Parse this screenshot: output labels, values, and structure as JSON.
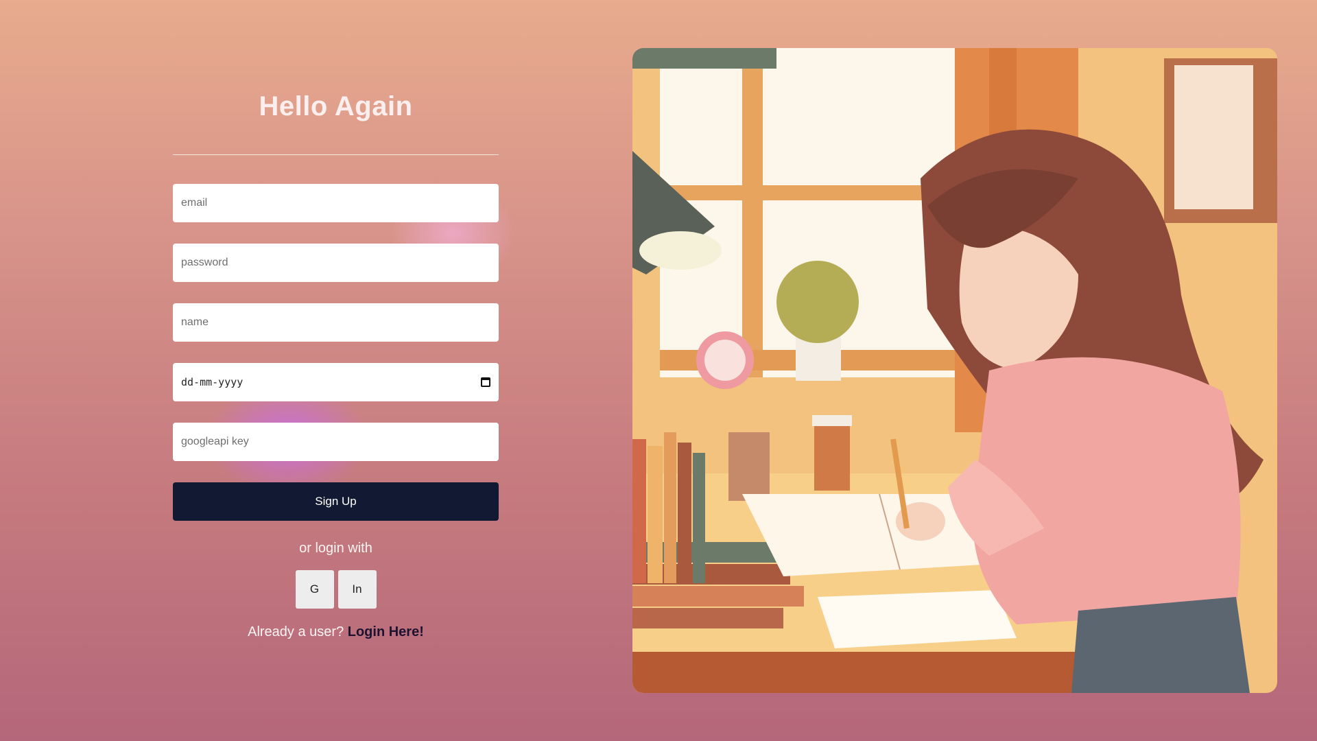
{
  "form": {
    "title": "Hello Again",
    "email_placeholder": "email",
    "password_placeholder": "password",
    "name_placeholder": "name",
    "date_placeholder": "dd-mm-yyyy",
    "googleapi_placeholder": "googleapi key",
    "signup_label": "Sign Up",
    "or_login_text": "or login with",
    "social": {
      "google_label": "G",
      "linkedin_label": "In"
    },
    "already_user_text": "Already a user?",
    "login_link_text": "Login Here!"
  },
  "illustration": {
    "icon": "illustration-icon"
  },
  "colors": {
    "button_bg": "#121a33",
    "link_color": "#1d1330"
  }
}
